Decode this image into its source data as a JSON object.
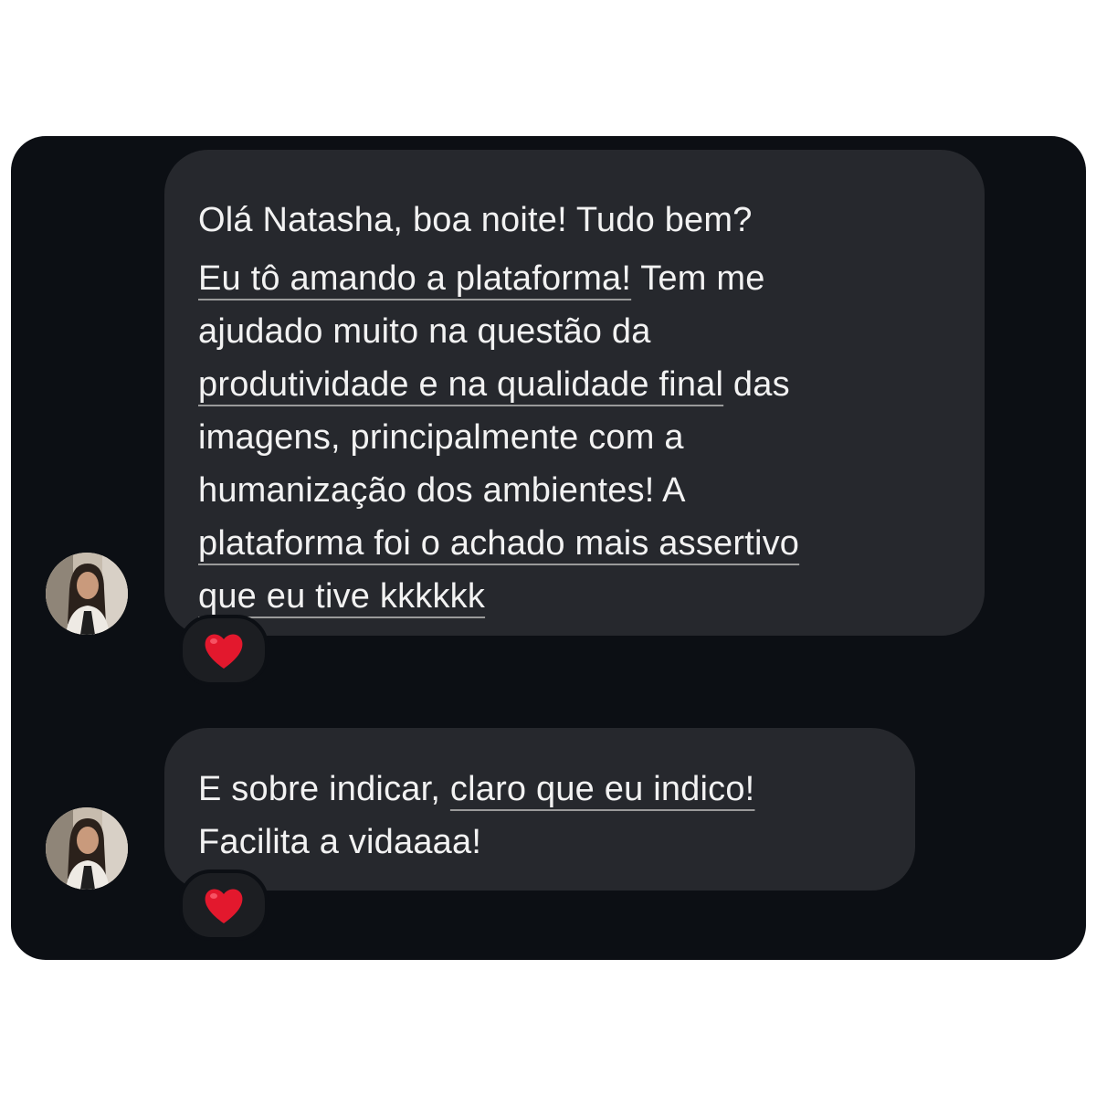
{
  "conversation": {
    "messages": [
      {
        "lines": [
          [
            {
              "text": "Olá Natasha, boa noite! Tudo bem?",
              "underline": false
            }
          ],
          [
            {
              "text": "Eu tô amando a plataforma!",
              "underline": true
            },
            {
              "text": " Tem me",
              "underline": false
            }
          ],
          [
            {
              "text": "ajudado muito na questão da",
              "underline": false
            }
          ],
          [
            {
              "text": "produtividade e na qualidade final",
              "underline": true
            },
            {
              "text": " das",
              "underline": false
            }
          ],
          [
            {
              "text": "imagens, principalmente com a",
              "underline": false
            }
          ],
          [
            {
              "text": "humanização dos ambientes! A",
              "underline": false
            }
          ],
          [
            {
              "text": "plataforma foi o achado mais assertivo",
              "underline": true
            }
          ],
          [
            {
              "text": "que eu tive kkkkkk",
              "underline": true
            }
          ]
        ],
        "reaction": "red-heart-icon"
      },
      {
        "lines": [
          [
            {
              "text": "E sobre indicar, ",
              "underline": false
            },
            {
              "text": "claro que eu indico!",
              "underline": true
            }
          ],
          [
            {
              "text": "Facilita a vidaaaa!",
              "underline": false
            }
          ]
        ],
        "reaction": "red-heart-icon"
      }
    ]
  },
  "colors": {
    "background": "#0c0f14",
    "bubble": "#26282d",
    "text": "#f2f2f2",
    "heart": "#e3182d"
  }
}
